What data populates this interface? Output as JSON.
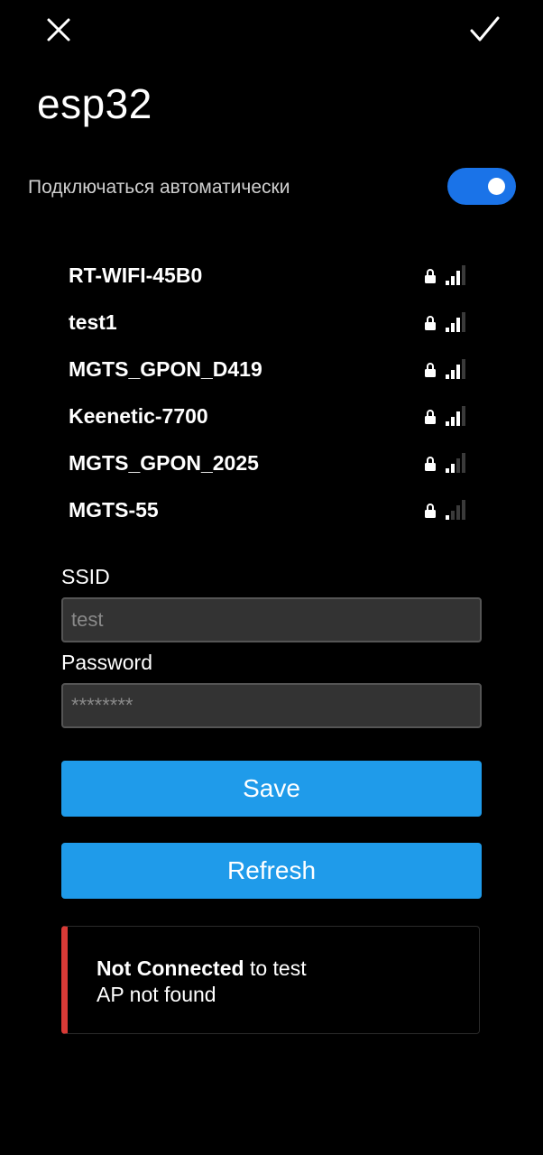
{
  "header": {
    "close_icon": "close-icon",
    "confirm_icon": "check-icon"
  },
  "title": "esp32",
  "auto_connect": {
    "label": "Подключаться автоматически",
    "enabled": true,
    "accent": "#1a73e8"
  },
  "networks": [
    {
      "name": "RT-WIFI-45B0",
      "secured": true,
      "signal_bars": 3
    },
    {
      "name": "test1",
      "secured": true,
      "signal_bars": 3
    },
    {
      "name": "MGTS_GPON_D419",
      "secured": true,
      "signal_bars": 3
    },
    {
      "name": "Keenetic-7700",
      "secured": true,
      "signal_bars": 3
    },
    {
      "name": "MGTS_GPON_2025",
      "secured": true,
      "signal_bars": 2
    },
    {
      "name": "MGTS-55",
      "secured": true,
      "signal_bars": 1
    }
  ],
  "form": {
    "ssid_label": "SSID",
    "ssid_placeholder": "test",
    "password_label": "Password",
    "password_placeholder": "********"
  },
  "buttons": {
    "save": "Save",
    "refresh": "Refresh",
    "color": "#1f9bea"
  },
  "status": {
    "state": "Not Connected",
    "target": " to test",
    "detail": "AP not found",
    "accent": "#d93a36"
  }
}
